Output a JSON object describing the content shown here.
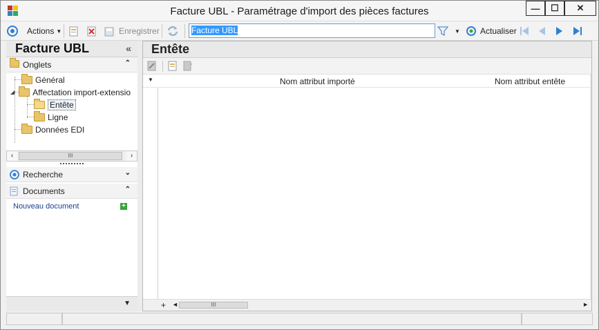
{
  "window": {
    "title": "Facture UBL -  Paramétrage d'import des pièces factures",
    "minimize_glyph": "—",
    "maximize_glyph": "☐",
    "close_glyph": "✕"
  },
  "toolbar": {
    "actions_label": "Actions",
    "save_label": "Enregistrer",
    "search_value": "Facture UBL",
    "refresh_label": "Actualiser"
  },
  "left_pane": {
    "title": "Facture UBL",
    "collapse_glyph": "«",
    "onglets_label": "Onglets",
    "tree": {
      "general": "Général",
      "affectation": "Affectation import-extensio",
      "entete": "Entête",
      "ligne": "Ligne",
      "donnees_edi": "Données EDI"
    },
    "recherche_label": "Recherche",
    "documents_label": "Documents",
    "new_document_label": "Nouveau document",
    "scroll_thumb_glyph": "III"
  },
  "right_pane": {
    "title": "Entête",
    "columns": [
      "Nom attribut importé",
      "Nom attribut entête"
    ],
    "add_row_glyph": "+",
    "scroll_thumb_glyph": "III"
  },
  "icons": {
    "app": "app-icon",
    "actions": "target-icon",
    "new": "new-document-icon",
    "delete": "delete-icon",
    "save": "save-icon",
    "sync": "sync-icon",
    "filter": "filter-icon",
    "refresh": "refresh-icon",
    "first": "first-record-icon",
    "prev": "previous-record-icon",
    "next": "next-record-icon",
    "last": "last-record-icon"
  },
  "colors": {
    "accent_blue": "#2f7fd3",
    "selection": "#3399ff",
    "folder": "#e8c46a",
    "link": "#1a3f8f",
    "add_green": "#3aa33a"
  }
}
